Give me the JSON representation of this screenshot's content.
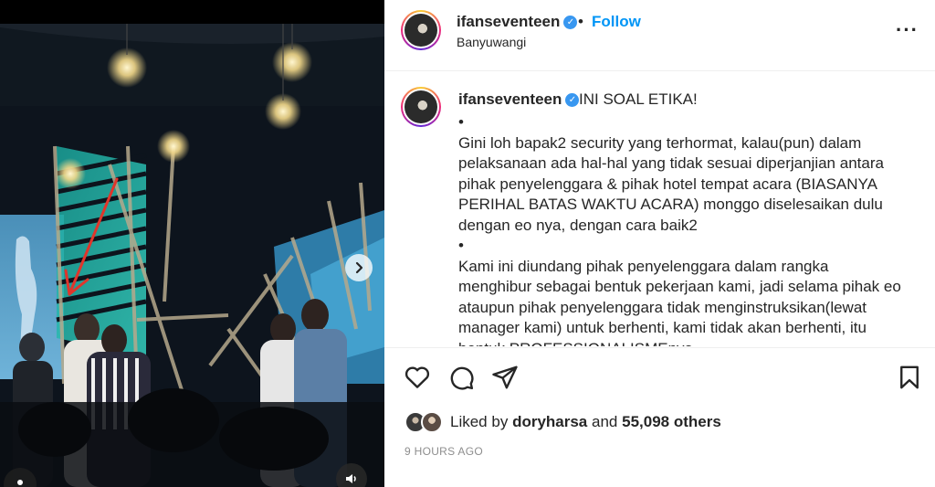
{
  "header": {
    "username": "ifanseventeen",
    "separator": "•",
    "follow_label": "Follow",
    "location": "Banyuwangi",
    "more_label": "···"
  },
  "caption": {
    "username": "ifanseventeen",
    "headline": "INI SOAL ETIKA!",
    "paragraphs": [
      "•",
      "Gini loh bapak2 security yang terhormat, kalau(pun) dalam pelaksanaan ada hal-hal yang tidak sesuai diperjanjian antara pihak penyelenggara & pihak hotel tempat acara (BIASANYA PERIHAL BATAS WAKTU ACARA) monggo diselesaikan dulu dengan eo nya, dengan cara baik2",
      "•",
      "Kami ini diundang pihak penyelenggara dalam rangka menghibur sebagai bentuk pekerjaan kami, jadi selama pihak eo ataupun pihak penyelenggara tidak menginstruksikan(lewat manager kami) untuk berhenti, kami tidak akan berhenti, itu bentuk PROFESSIONALISMEnya"
    ]
  },
  "likes": {
    "prefix": "Liked by",
    "user": "doryharsa",
    "conjunction": "and",
    "count_text": "55,098 others"
  },
  "timestamp": "9 HOURS AGO",
  "icons": {
    "like": "heart-icon",
    "comment": "comment-icon",
    "share": "paper-plane-icon",
    "save": "bookmark-icon",
    "next": "chevron-right-icon",
    "sound": "speaker-icon",
    "tag": "user-tag-icon"
  },
  "colors": {
    "accent": "#0095f6",
    "verified": "#3897f0",
    "text": "#262626",
    "muted": "#8e8e8e"
  }
}
